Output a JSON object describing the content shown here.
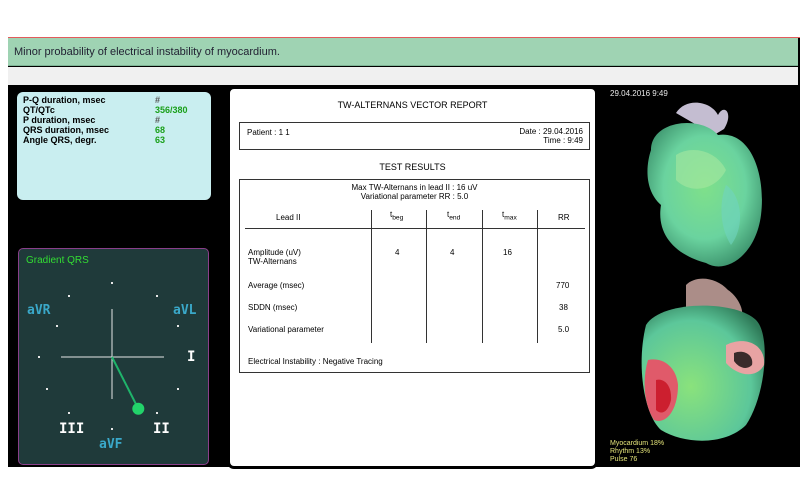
{
  "banner": {
    "message": "Minor probability of electrical instability of myocardium."
  },
  "parameters": [
    {
      "label": "P-Q duration, msec",
      "value": "#"
    },
    {
      "label": "QT/QTc",
      "value": "356/380"
    },
    {
      "label": "P duration, msec",
      "value": "#"
    },
    {
      "label": "QRS duration, msec",
      "value": "68"
    },
    {
      "label": "Angle QRS, degr.",
      "value": "63"
    }
  ],
  "gradient": {
    "title": "Gradient QRS",
    "leads": {
      "avr": "aVR",
      "avl": "aVL",
      "i": "I",
      "iii": "III",
      "ii": "II",
      "avf": "aVF"
    },
    "angle_deg": 63,
    "colors": {
      "vector": "#1fb36a",
      "axis": "#e6e6e6",
      "label": "#3aa8c9"
    }
  },
  "report": {
    "title": "TW-ALTERNANS VECTOR REPORT",
    "patient_label": "Patient :  1   1",
    "date_label": "Date : 29.04.2016",
    "time_label": "Time : 9:49",
    "results_title": "TEST RESULTS",
    "max_tw": "Max TW-Alternans in lead II  : 16 uV",
    "var_param_rr": "Variational parameter RR   :  5.0",
    "headers": {
      "lead": "Lead II",
      "t_beg": "t",
      "t_beg_sub": "beg",
      "t_end": "t",
      "t_end_sub": "end",
      "t_max": "t",
      "t_max_sub": "max",
      "rr": "RR"
    },
    "rows": {
      "amplitude_label_1": "Amplitude (uV)",
      "amplitude_label_2": "TW-Alternans",
      "amp_tbeg": "4",
      "amp_tend": "4",
      "amp_tmax": "16",
      "average_label": "Average (msec)",
      "average_rr": "770",
      "sddn_label": "SDDN (msec)",
      "sddn_rr": "38",
      "variational_label": "Variational parameter",
      "variational_rr": "5.0"
    },
    "instability": "Electrical Instability : Negative Tracing"
  },
  "heart": {
    "date": "29.04.2016 9:49",
    "myocardium": "Myocardium 18%",
    "rhythm": "Rhythm 13%",
    "pulse": "Pulse 76"
  }
}
